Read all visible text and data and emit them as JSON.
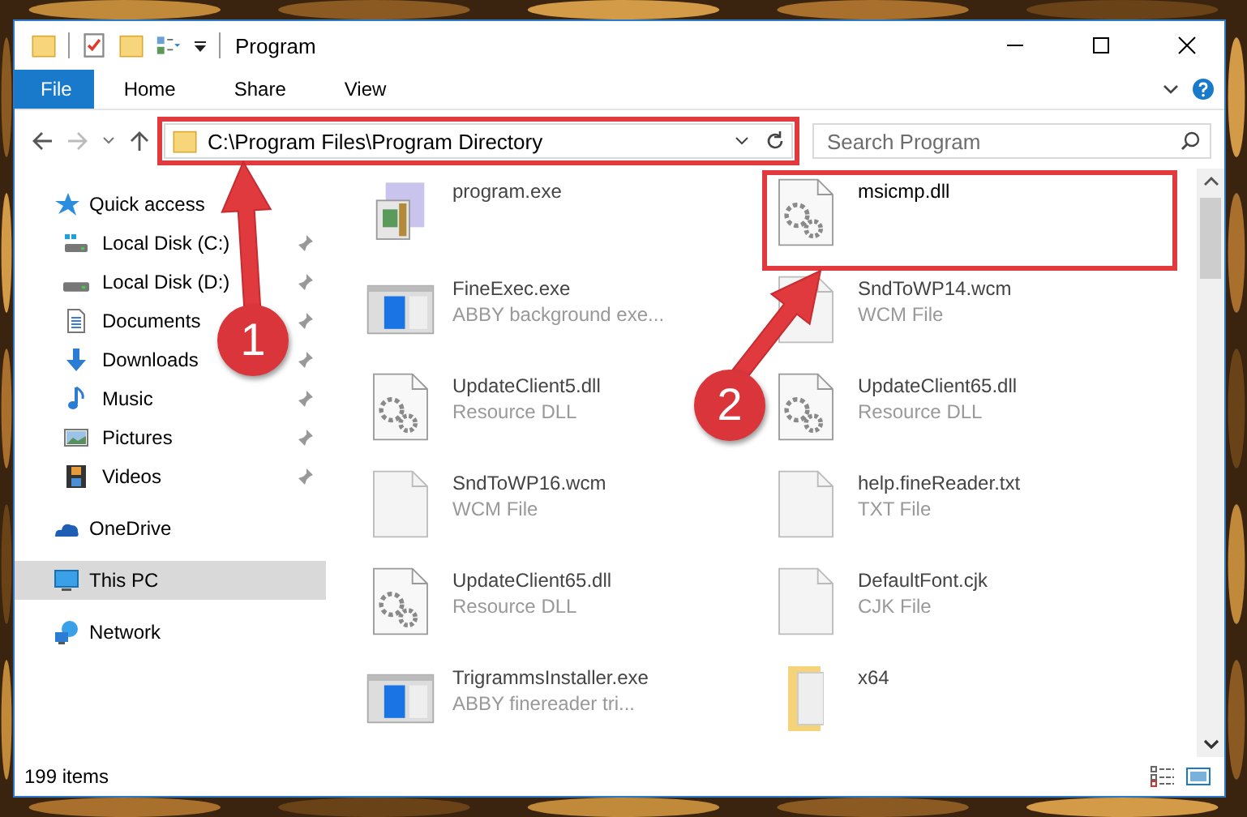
{
  "window": {
    "title": "Program"
  },
  "ribbon_tabs": [
    {
      "label": "File",
      "selected": true
    },
    {
      "label": "Home",
      "selected": false
    },
    {
      "label": "Share",
      "selected": false
    },
    {
      "label": "View",
      "selected": false
    }
  ],
  "address_bar": {
    "path": "C:\\Program Files\\Program Directory",
    "highlighted": true
  },
  "search": {
    "placeholder": "Search Program"
  },
  "sidebar": {
    "items": [
      {
        "label": "Quick access",
        "kind": "star",
        "selected": false,
        "children": [
          {
            "label": "Local Disk (C:)",
            "kind": "drive-c",
            "pinned": true,
            "selected": false
          },
          {
            "label": "Local Disk (D:)",
            "kind": "drive",
            "pinned": true,
            "selected": false
          },
          {
            "label": "Documents",
            "kind": "documents",
            "pinned": true,
            "selected": false
          },
          {
            "label": "Downloads",
            "kind": "downloads",
            "pinned": true,
            "selected": false
          },
          {
            "label": "Music",
            "kind": "music",
            "pinned": true,
            "selected": false
          },
          {
            "label": "Pictures",
            "kind": "pictures",
            "pinned": true,
            "selected": false
          },
          {
            "label": "Videos",
            "kind": "videos",
            "pinned": true,
            "selected": false
          }
        ]
      },
      {
        "label": "OneDrive",
        "kind": "cloud",
        "selected": false
      },
      {
        "label": "This PC",
        "kind": "pc",
        "selected": true
      },
      {
        "label": "Network",
        "kind": "network",
        "selected": false
      }
    ]
  },
  "files": [
    {
      "name": "program.exe",
      "kind": "setup",
      "highlighted": false
    },
    {
      "name": "msicmp.dll",
      "kind": "dll",
      "highlighted": true
    },
    {
      "name": "FineExec.exe",
      "type": "ABBY background exe...",
      "kind": "app",
      "highlighted": false
    },
    {
      "name": "SndToWP14.wcm",
      "type": "WCM File",
      "kind": "document",
      "highlighted": false
    },
    {
      "name": "UpdateClient5.dll",
      "type": "Resource DLL",
      "kind": "dll",
      "highlighted": false
    },
    {
      "name": "UpdateClient65.dll",
      "type": "Resource DLL",
      "kind": "dll",
      "highlighted": false
    },
    {
      "name": "SndToWP16.wcm",
      "type": "WCM File",
      "kind": "document",
      "highlighted": false
    },
    {
      "name": "help.fineReader.txt",
      "type": "TXT File",
      "kind": "document",
      "highlighted": false
    },
    {
      "name": "UpdateClient65.dll",
      "type": "Resource DLL",
      "kind": "dll",
      "highlighted": false
    },
    {
      "name": "DefaultFont.cjk",
      "type": "CJK File",
      "kind": "document",
      "highlighted": false
    },
    {
      "name": "TrigrammsInstaller.exe",
      "type": "ABBY finereader tri...",
      "kind": "app",
      "highlighted": false
    },
    {
      "name": "x64",
      "kind": "folder",
      "highlighted": false
    }
  ],
  "status_bar": {
    "count": "199 items"
  },
  "callouts": [
    {
      "number": "1"
    },
    {
      "number": "2"
    }
  ]
}
